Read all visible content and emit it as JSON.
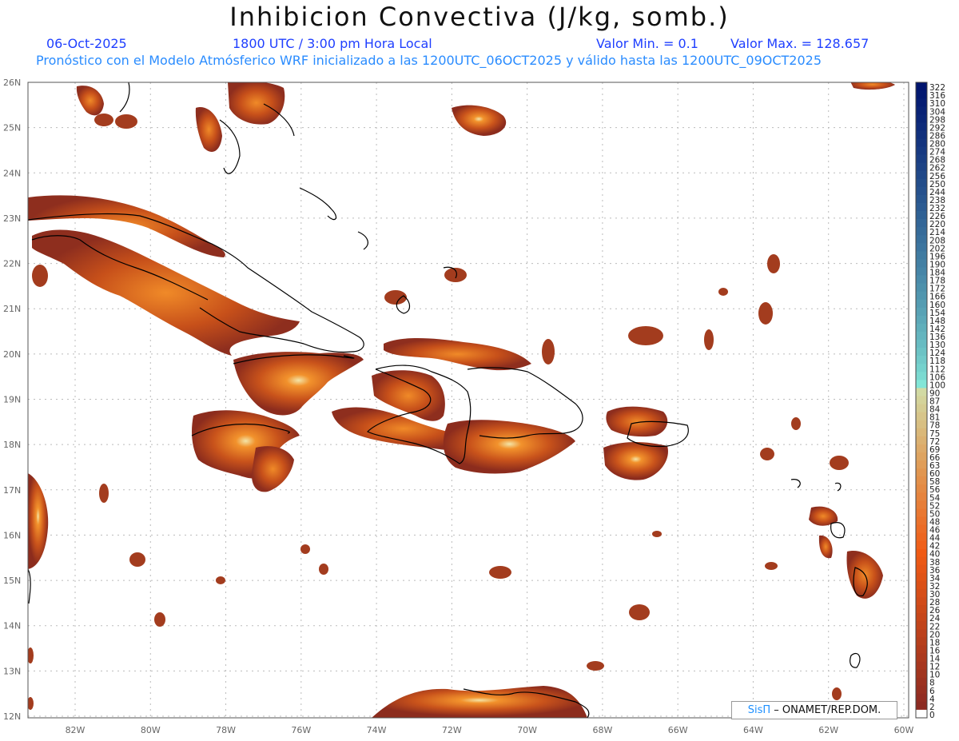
{
  "header": {
    "title": "Inhibicion Convectiva (J/kg, somb.)",
    "date": "06-Oct-2025",
    "time": "1800 UTC / 3:00 pm Hora Local",
    "min_label": "Valor Min. = 0.1",
    "max_label": "Valor Max. = 128.657",
    "info_line": "Pronóstico con el Modelo Atmósferico WRF inicializado a las 1200UTC_06OCT2025 y válido hasta las  1200UTC_09OCT2025"
  },
  "map": {
    "lat_labels": [
      "26N",
      "25N",
      "24N",
      "23N",
      "22N",
      "21N",
      "20N",
      "19N",
      "18N",
      "17N",
      "16N",
      "15N",
      "14N",
      "13N",
      "12N"
    ],
    "lon_labels": [
      "82W",
      "80W",
      "78W",
      "76W",
      "74W",
      "72W",
      "70W",
      "68W",
      "66W",
      "64W",
      "62W",
      "60W"
    ],
    "grid": true,
    "coastline_color": "#000000",
    "field_colors": {
      "low": "#8b2b1c",
      "mid": "#c8501a",
      "high": "#f07a20",
      "peak": "#f6e8a0"
    }
  },
  "colorbar": {
    "levels": [
      "322",
      "316",
      "310",
      "304",
      "298",
      "292",
      "286",
      "280",
      "274",
      "268",
      "262",
      "256",
      "250",
      "244",
      "238",
      "232",
      "226",
      "220",
      "214",
      "208",
      "202",
      "196",
      "190",
      "184",
      "178",
      "172",
      "166",
      "160",
      "154",
      "148",
      "142",
      "136",
      "130",
      "124",
      "118",
      "112",
      "106",
      "100",
      "90",
      "87",
      "84",
      "81",
      "78",
      "75",
      "72",
      "69",
      "66",
      "63",
      "60",
      "58",
      "56",
      "54",
      "52",
      "50",
      "48",
      "46",
      "44",
      "42",
      "40",
      "38",
      "36",
      "34",
      "32",
      "30",
      "28",
      "26",
      "24",
      "22",
      "20",
      "18",
      "16",
      "14",
      "12",
      "10",
      "8",
      "6",
      "4",
      "2",
      "0"
    ]
  },
  "credit": {
    "brand": "SisΠ",
    "text": " – ONAMET/REP.DOM."
  }
}
